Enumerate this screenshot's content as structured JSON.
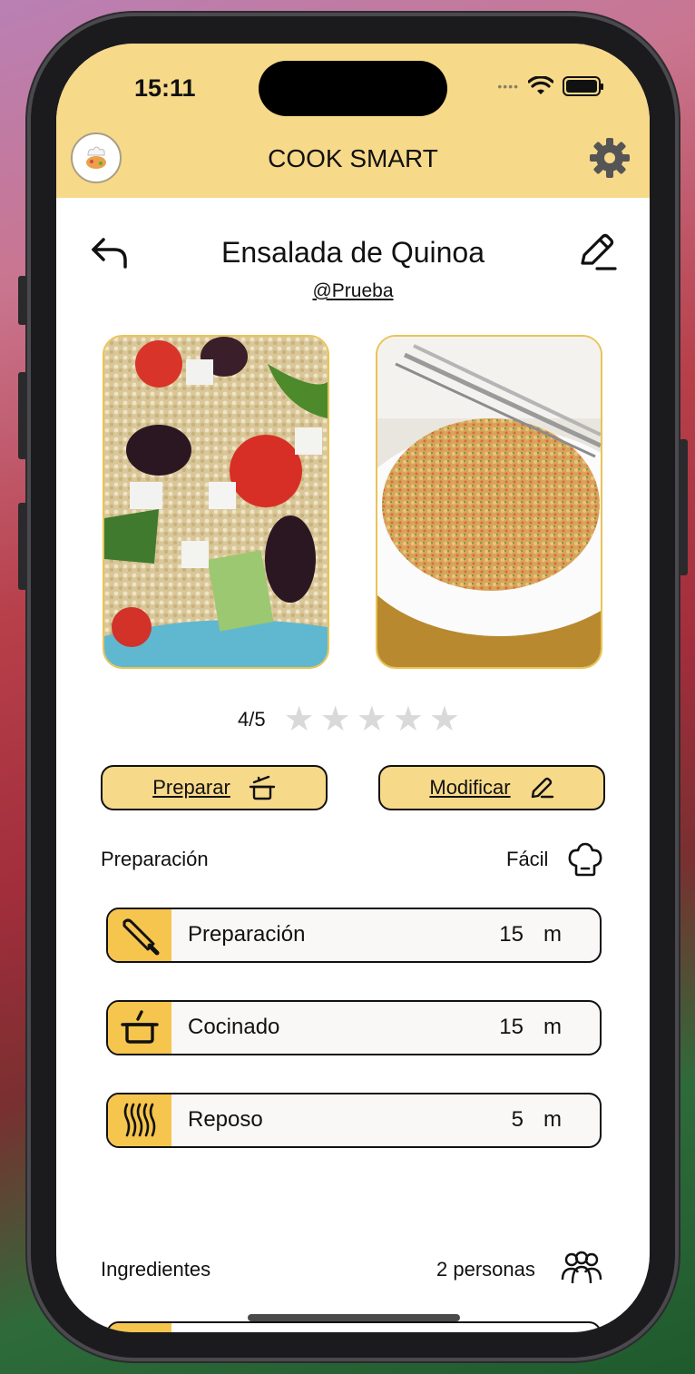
{
  "status": {
    "time": "15:11"
  },
  "app": {
    "title": "COOK SMART"
  },
  "recipe": {
    "title": "Ensalada de Quinoa",
    "author": "@Prueba"
  },
  "rating": {
    "label": "4/5",
    "stars_total": 5
  },
  "actions": {
    "prepare_label": "Preparar",
    "modify_label": "Modificar"
  },
  "preparation": {
    "section_label": "Preparación",
    "difficulty": "Fácil",
    "steps": [
      {
        "name": "Preparación",
        "value": "15",
        "unit": "m",
        "icon": "knife-icon"
      },
      {
        "name": "Cocinado",
        "value": "15",
        "unit": "m",
        "icon": "pot-icon"
      },
      {
        "name": "Reposo",
        "value": "5",
        "unit": "m",
        "icon": "steam-icon"
      }
    ]
  },
  "ingredients": {
    "section_label": "Ingredientes",
    "servings": "2 personas"
  },
  "colors": {
    "header": "#f7d98a",
    "accent": "#f5c54e",
    "photo_border": "#e9c455"
  }
}
